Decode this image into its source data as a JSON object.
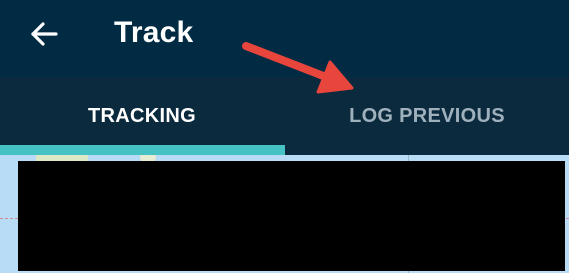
{
  "app_bar": {
    "title": "Track",
    "back_icon": "arrow-left-icon"
  },
  "tabs": [
    {
      "label": "TRACKING",
      "selected": true
    },
    {
      "label": "LOG PREVIOUS",
      "selected": false
    }
  ],
  "colors": {
    "app_bar_bg": "#002b43",
    "tab_bar_bg": "#0c2a3d",
    "tab_indicator": "#45c2c3",
    "active_tab_text": "#ffffff",
    "inactive_tab_text": "#9fb1bd",
    "annotation_arrow": "#e8453c",
    "map_water": "#b8dcf5"
  },
  "map": {
    "content_redacted": true
  }
}
